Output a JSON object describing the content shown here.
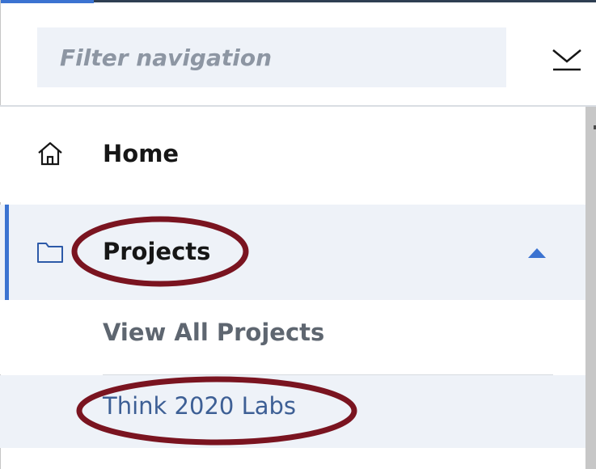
{
  "filter": {
    "placeholder": "Filter navigation"
  },
  "nav": {
    "items": [
      {
        "label": "Home",
        "icon": "home-icon"
      },
      {
        "label": "Projects",
        "icon": "folder-icon",
        "expanded": true
      }
    ],
    "projects_children": [
      {
        "label": "View All Projects"
      },
      {
        "label": "Think 2020 Labs",
        "selected": true
      }
    ]
  },
  "colors": {
    "accent": "#3b73d1",
    "annotation": "#7a1420",
    "highlight_bg": "#eef2f8"
  }
}
